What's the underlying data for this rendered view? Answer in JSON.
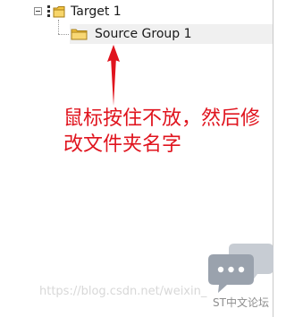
{
  "tree": {
    "root": {
      "label": "Target 1",
      "icon": "target-icon",
      "expanded": true
    },
    "children": [
      {
        "label": "Source Group 1",
        "icon": "folder-icon"
      }
    ]
  },
  "annotation": {
    "text": "鼠标按住不放，然后修改文件夹名字",
    "color": "#e0141e"
  },
  "watermark": {
    "url": "https://blog.csdn.net/weixin_",
    "brand": "ST中文论坛",
    "icon": "chat-bubbles-icon"
  }
}
